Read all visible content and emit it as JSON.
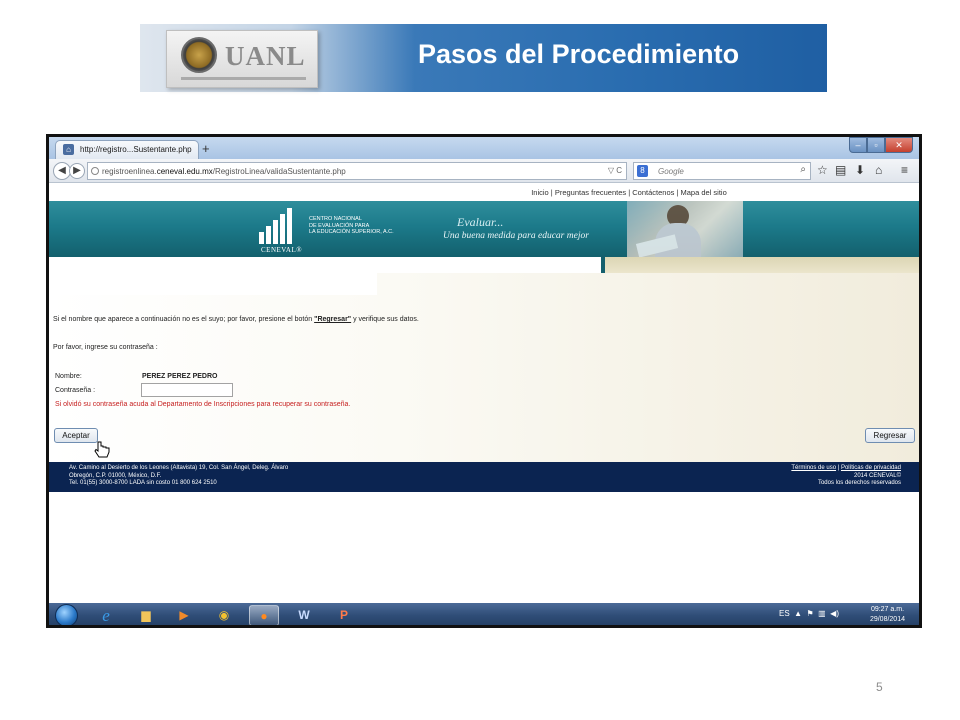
{
  "slide": {
    "logo_text": "UANL",
    "title": "Pasos del Procedimiento",
    "page_number": "5"
  },
  "browser": {
    "tab_title": "http://registro...Sustentante.php",
    "new_tab_symbol": "+",
    "url_prefix": "registroenlinea.",
    "url_domain": "ceneval.edu.mx",
    "url_path": "/RegistroLinea/validaSustentante.php",
    "url_right": "▽ C",
    "search_engine_badge": "8",
    "search_placeholder": "Google",
    "icons": [
      "back-icon",
      "forward-icon",
      "search-icon",
      "star-icon",
      "bookmarks-icon",
      "download-icon",
      "home-icon",
      "menu-icon"
    ]
  },
  "page": {
    "toplinks": "Inicio | Preguntas frecuentes | Contáctenos | Mapa del sitio",
    "logo_lines": [
      "CENTRO NACIONAL",
      "DE EVALUACIÓN PARA",
      "LA EDUCACIÓN SUPERIOR, A.C."
    ],
    "logo_word": "CENEVAL®",
    "slogan_line1": "Evaluar...",
    "slogan_line2": "Una buena medida para educar mejor",
    "notice_before": "Si el nombre que aparece a continuación no es el suyo; por favor, presione el botón ",
    "notice_link": "\"Regresar\"",
    "notice_after": " y verifique sus datos.",
    "password_prompt": "Por favor, ingrese su contraseña :",
    "name_label": "Nombre:",
    "name_value": "PEREZ PEREZ PEDRO",
    "password_label": "Contraseña :",
    "password_value": "",
    "forgot_text": "Si olvidó su contraseña acuda al Departamento de Inscripciones para recuperar su contraseña.",
    "accept_label": "Aceptar",
    "back_label": "Regresar",
    "footer_left": [
      "Av. Camino al Desierto de los Leones (Altavista) 19, Col. San Ángel, Deleg. Álvaro",
      "Obregón, C.P. 01000, México, D.F.",
      "Tel. 01(55) 3000-8700 LADA sin costo 01 800 624 2510"
    ],
    "footer_terms": "Términos de uso",
    "footer_sep": " | ",
    "footer_privacy": "Políticas de privacidad",
    "footer_copyright": "2014 CENEVAL©",
    "footer_rights": "Todos los derechos reservados"
  },
  "taskbar": {
    "apps": [
      "ie-icon",
      "explorer-icon",
      "media-player-icon",
      "chrome-icon",
      "firefox-icon",
      "word-icon",
      "powerpoint-icon"
    ],
    "language": "ES",
    "time": "09:27 a.m.",
    "date": "29/08/2014"
  },
  "colors": {
    "banner_blue": "#2a6db0",
    "ceneval_teal": "#1c7a8a",
    "footer_navy": "#0b2451",
    "error_red": "#c62020"
  }
}
